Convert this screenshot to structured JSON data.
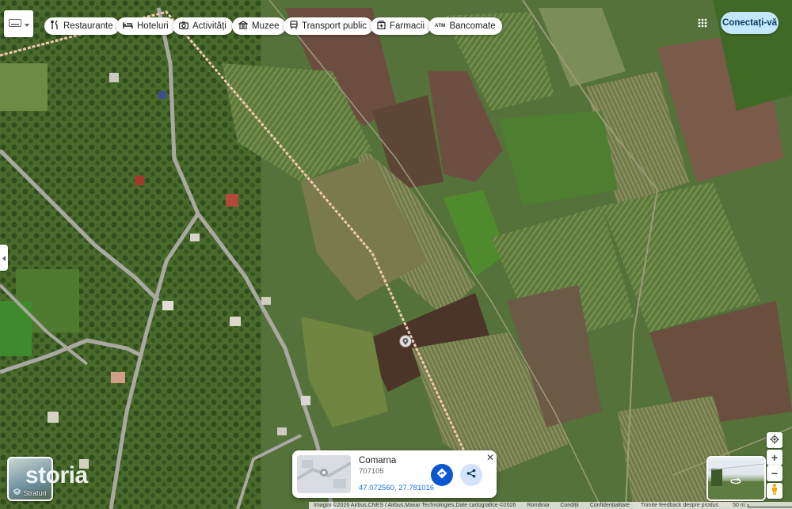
{
  "toolbar": {
    "keyboard_icon": "keyboard-icon",
    "chips": [
      {
        "label": "Restaurante",
        "icon": "fork-knife-icon"
      },
      {
        "label": "Hoteluri",
        "icon": "bed-icon"
      },
      {
        "label": "Activități",
        "icon": "camera-icon"
      },
      {
        "label": "Muzee",
        "icon": "museum-icon"
      },
      {
        "label": "Transport public",
        "icon": "train-icon"
      },
      {
        "label": "Farmacii",
        "icon": "pharmacy-icon"
      },
      {
        "label": "Bancomate",
        "icon": "atm-icon"
      }
    ],
    "apps_icon": "apps-grid-icon",
    "signin_label": "Conectați-vă"
  },
  "layers": {
    "label": "Straturi",
    "icon": "layers-icon"
  },
  "watermark": "storia",
  "place_card": {
    "title": "Comarna",
    "postal_code": "707105",
    "coordinates": "47.072560, 27.781016",
    "directions_icon": "directions-icon",
    "share_icon": "share-icon",
    "close_label": "✕"
  },
  "controls": {
    "locate_icon": "my-location-icon",
    "zoom_in": "+",
    "zoom_out": "−",
    "pegman_icon": "pegman-icon",
    "street_view_icon": "360-rotate-icon"
  },
  "footer": {
    "imagery": "Imagini ©2026 Airbus,CNES / Airbus,Maxar Technologies,Date cartografice ©2026",
    "country": "România",
    "terms": "Condiții",
    "privacy": "Confidențialitate",
    "feedback": "Trimite feedback despre produs",
    "scale": "50 m"
  },
  "colors": {
    "route_line": "#f2c9b0",
    "signin_bg": "#c2e7ff",
    "directions_bg": "#0b57d0",
    "link": "#1a73e8"
  }
}
